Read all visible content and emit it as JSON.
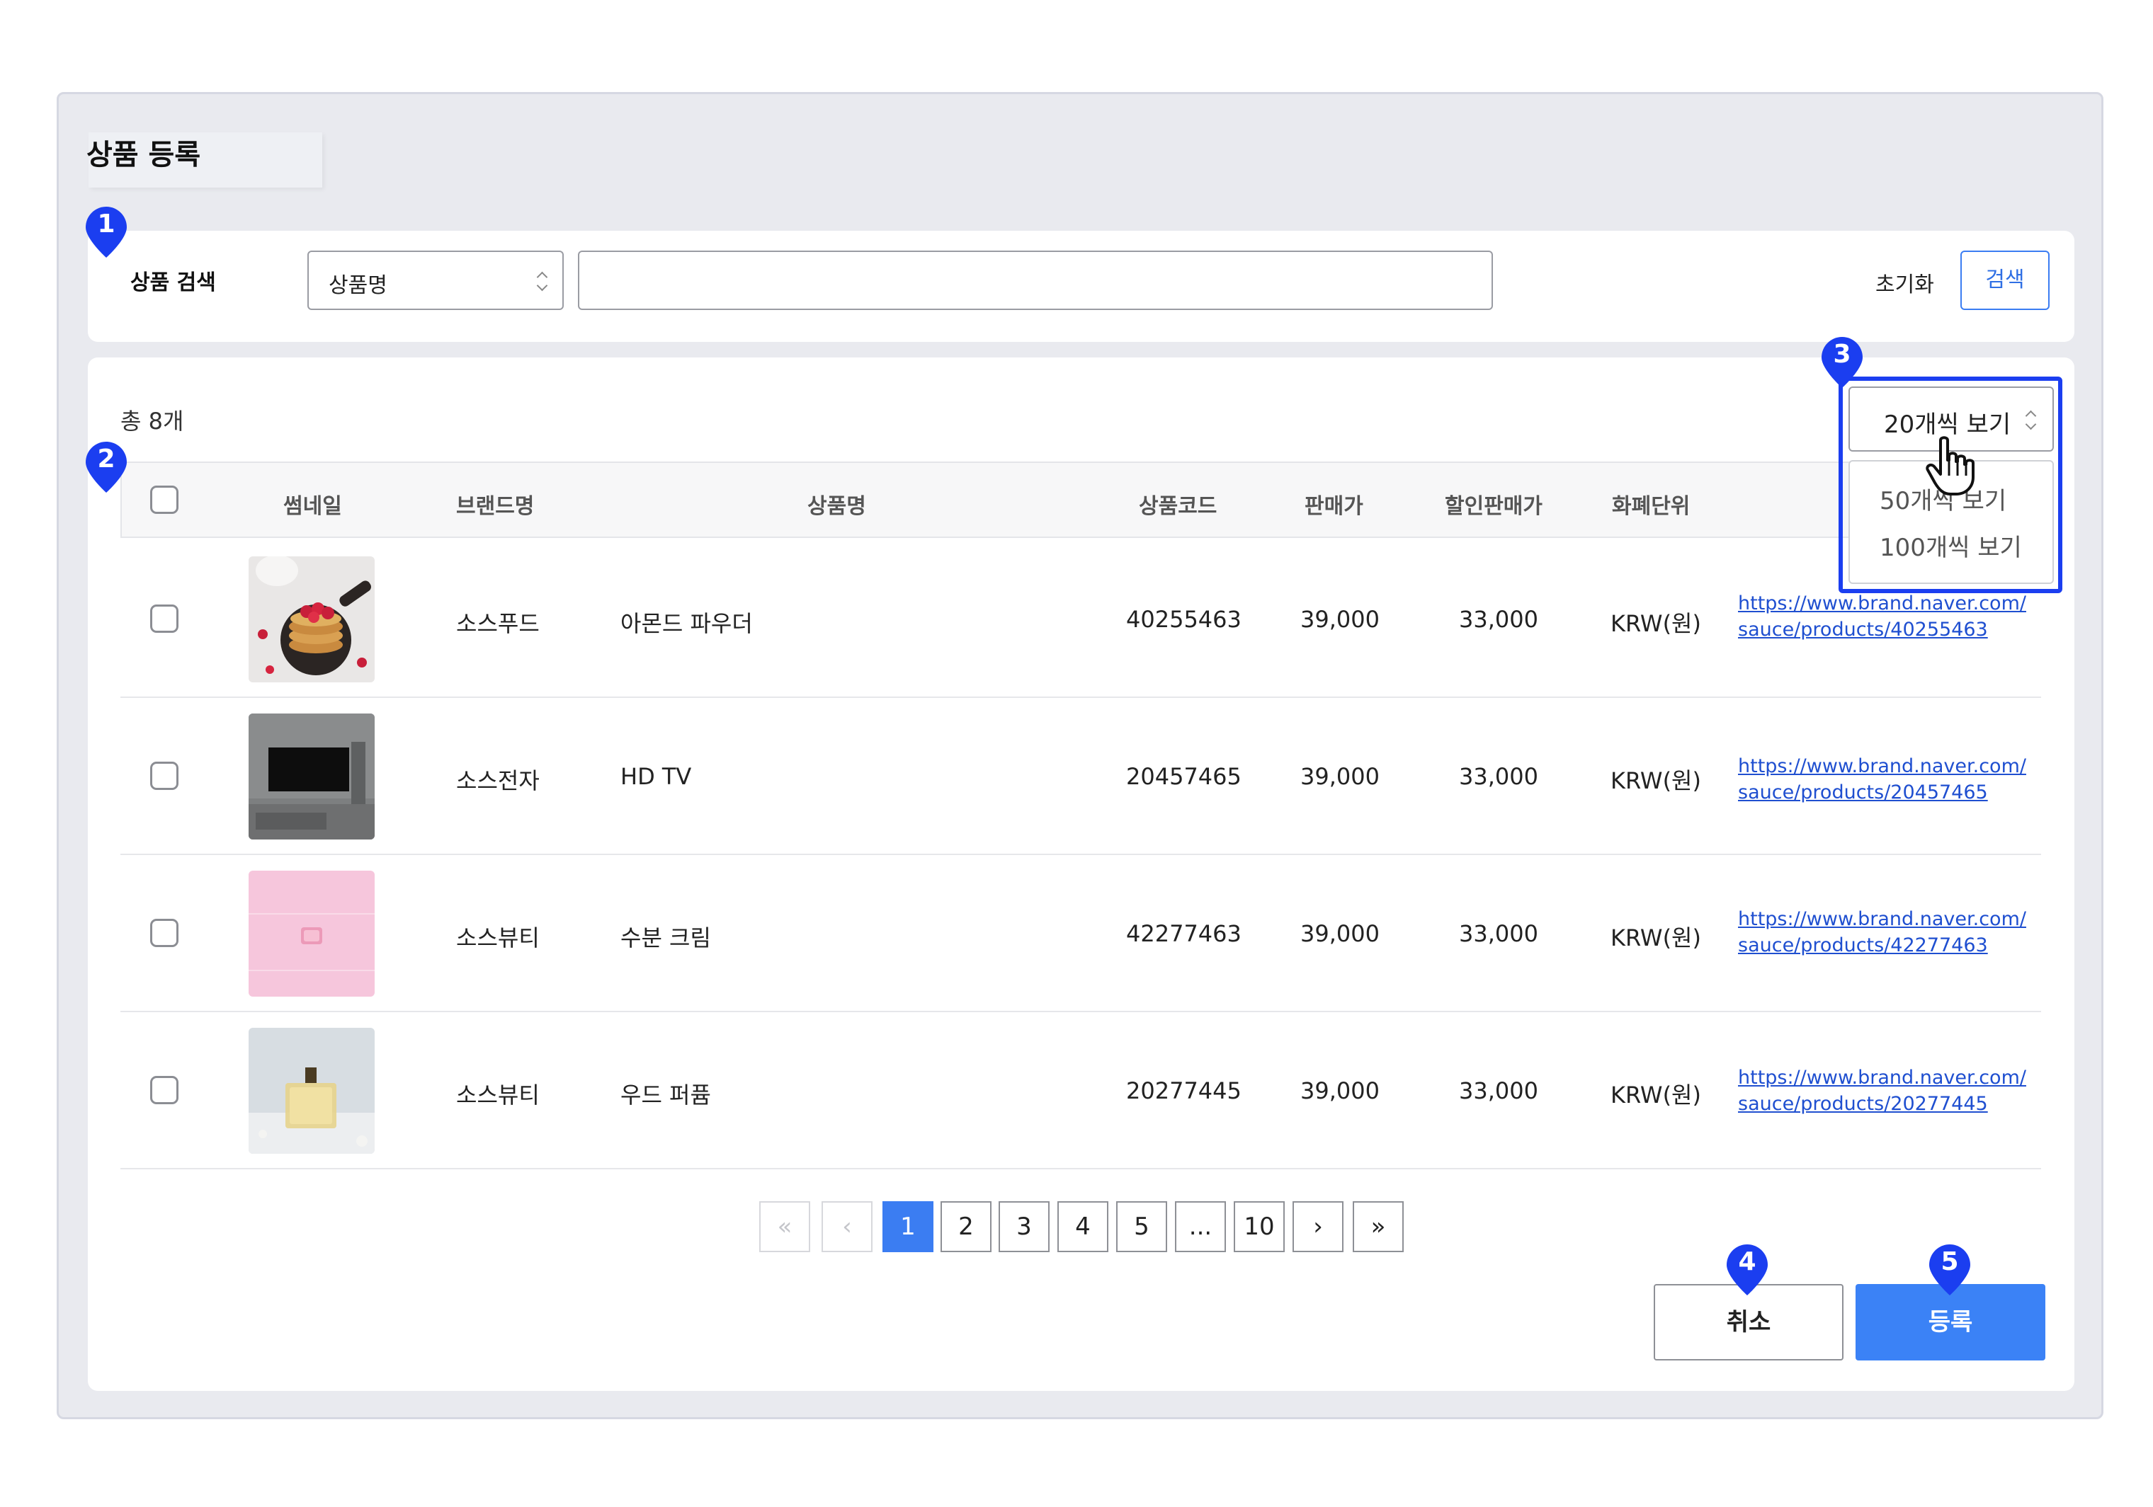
{
  "page": {
    "title": "상품 등록"
  },
  "search": {
    "label": "상품 검색",
    "field_select": "상품명",
    "input_value": "",
    "reset_label": "초기화",
    "search_label": "검색"
  },
  "list": {
    "total": "총 8개",
    "page_size": {
      "current": "20개씩 보기",
      "options": [
        "50개씩 보기",
        "100개씩 보기"
      ]
    },
    "columns": [
      "썸네일",
      "브랜드명",
      "상품명",
      "상품코드",
      "판매가",
      "할인판매가",
      "화폐단위"
    ],
    "rows": [
      {
        "brand": "소스푸드",
        "name": "아몬드 파우더",
        "code": "40255463",
        "price": "39,000",
        "sale_price": "33,000",
        "currency": "KRW(원)",
        "link1": "https://www.brand.naver.com/",
        "link2": "sauce/products/40255463",
        "thumb": "pancake-image"
      },
      {
        "brand": "소스전자",
        "name": "HD TV",
        "code": "20457465",
        "price": "39,000",
        "sale_price": "33,000",
        "currency": "KRW(원)",
        "link1": "https://www.brand.naver.com/",
        "link2": "sauce/products/20457465",
        "thumb": "tv-image"
      },
      {
        "brand": "소스뷰티",
        "name": "수분 크림",
        "code": "42277463",
        "price": "39,000",
        "sale_price": "33,000",
        "currency": "KRW(원)",
        "link1": "https://www.brand.naver.com/",
        "link2": "sauce/products/42277463",
        "thumb": "cream-image"
      },
      {
        "brand": "소스뷰티",
        "name": "우드 퍼퓸",
        "code": "20277445",
        "price": "39,000",
        "sale_price": "33,000",
        "currency": "KRW(원)",
        "link1": "https://www.brand.naver.com/",
        "link2": "sauce/products/20277445",
        "thumb": "perfume-image"
      }
    ]
  },
  "pagination": {
    "first": "«",
    "prev": "‹",
    "pages": [
      "1",
      "2",
      "3",
      "4",
      "5",
      "...",
      "10"
    ],
    "next": "›",
    "last": "»",
    "current": "1"
  },
  "actions": {
    "cancel": "취소",
    "register": "등록"
  },
  "annotations": [
    "1",
    "2",
    "3",
    "4",
    "5"
  ],
  "colors": {
    "accent": "#3b82f6",
    "annotation": "#1b3ef0",
    "link": "#1f4fd0"
  }
}
